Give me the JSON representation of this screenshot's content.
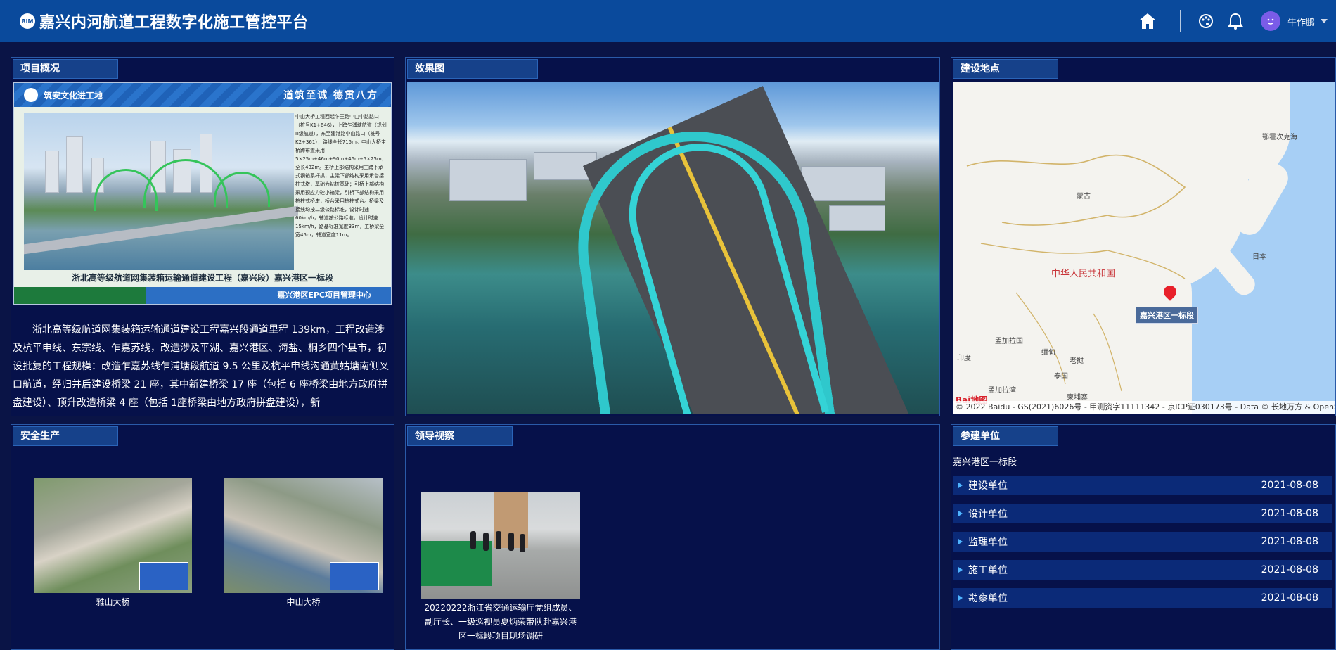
{
  "header": {
    "logo_text": "BIM",
    "title": "嘉兴内河航道工程数字化施工管控平台",
    "username": "牛作鹏"
  },
  "overview": {
    "title": "项目概况",
    "board": {
      "brand": "筑安文化进工地",
      "slogan": "道筑至诚  德贯八方",
      "text": "中山大桥工程西起乍王路中山中路路口（桩号K1+646），上跨乍浦塘航道（规划Ⅲ级航道），东至建港路中山路口（桩号K2+361），路线全长715m。中山大桥主桥跨布置采用5×25m+46m+90m+46m+5×25m，全长432m。主桥上部结构采用三跨下承式钢箱系杆拱，主梁下部结构采用承台接柱式墩，基础为钻桩基础；引桥上部结构采用预应力砼小箱梁，引桥下部结构采用桩柱式桥墩，桥台采用桩柱式台。桥梁及接线均按二级公路标准，设计时速60km/h，辅道按公路标准，设计时速15km/h，路基标准宽度33m，主桥梁全宽45m，辅道宽度11m。",
      "caption": "浙北高等级航道网集装箱运输通道建设工程（嘉兴段）嘉兴港区一标段",
      "footer": "嘉兴港区EPC项目管理中心"
    },
    "description": "浙北高等级航道网集装箱运输通道建设工程嘉兴段通道里程 139km，工程改造涉及杭平申线、东宗线、乍嘉苏线，改造涉及平湖、嘉兴港区、海盐、桐乡四个县市，初设批复的工程规模：改造乍嘉苏线乍浦塘段航道 9.5 公里及杭平申线沟通黄姑塘南侧叉口航道，经归并后建设桥梁 21 座，其中新建桥梁 17 座（包括 6 座桥梁由地方政府拼盘建设）、顶升改造桥梁 4 座（包括 1座桥梁由地方政府拼盘建设），新"
  },
  "rendering": {
    "title": "效果图",
    "carousel_total": 3,
    "carousel_active": 2
  },
  "location": {
    "title": "建设地点",
    "labels": [
      "蒙古",
      "中华人民共和国",
      "日本",
      "鄂霍次克海",
      "孟加拉国",
      "缅甸",
      "老挝",
      "泰国",
      "柬埔寨",
      "印度",
      "孟加拉湾"
    ],
    "pin_label": "嘉兴港区一标段",
    "logo": "Bai地图",
    "copyright": "© 2022 Baidu - GS(2021)6026号 - 甲测资字11111342 - 京ICP证030173号 - Data © 长地万方 & OpenS"
  },
  "safety": {
    "title": "安全生产",
    "photos": [
      {
        "caption": "雅山大桥"
      },
      {
        "caption": "中山大桥"
      }
    ]
  },
  "inspection": {
    "title": "领导视察",
    "caption": "20220222浙江省交通运输厅党组成员、副厅长、一级巡视员夏炳荣带队赴嘉兴港区一标段项目现场调研"
  },
  "units": {
    "title": "参建单位",
    "section": "嘉兴港区一标段",
    "rows": [
      {
        "name": "建设单位",
        "date": "2021-08-08"
      },
      {
        "name": "设计单位",
        "date": "2021-08-08"
      },
      {
        "name": "监理单位",
        "date": "2021-08-08"
      },
      {
        "name": "施工单位",
        "date": "2021-08-08"
      },
      {
        "name": "勘察单位",
        "date": "2021-08-08"
      }
    ]
  },
  "colors": {
    "header_bg": "#0a4a9c",
    "page_bg": "#0a1446",
    "panel_bg": "#06114a",
    "panel_border": "#2a5aa8",
    "accent": "#4fb4ff",
    "pin": "#e8202a"
  }
}
